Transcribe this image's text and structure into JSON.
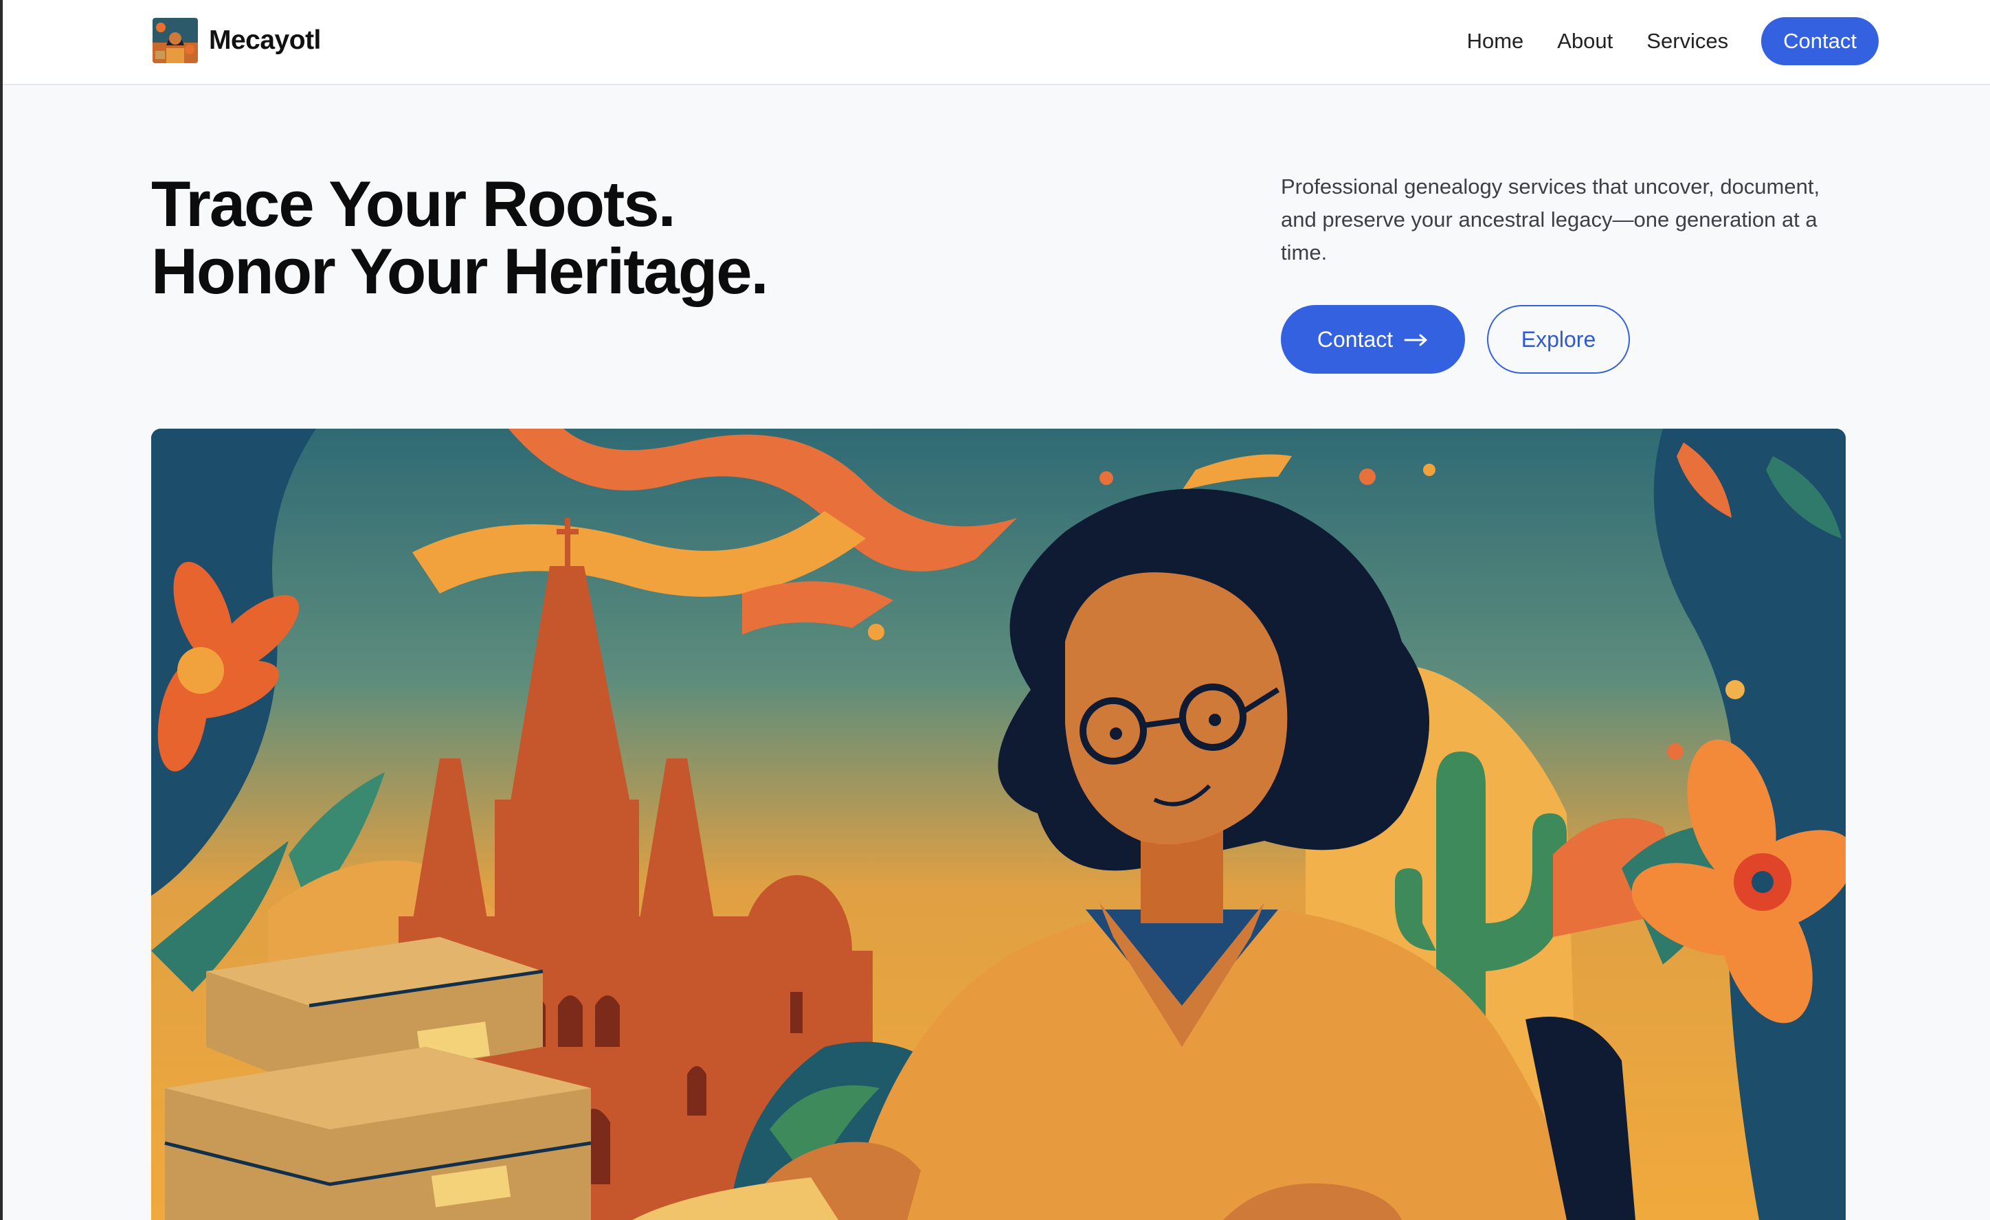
{
  "brand": {
    "name": "Mecayotl",
    "logo_icon": "painting-thumbnail-icon"
  },
  "nav": {
    "items": [
      {
        "label": "Home"
      },
      {
        "label": "About"
      },
      {
        "label": "Services"
      }
    ],
    "cta_label": "Contact"
  },
  "hero": {
    "title_line1": "Trace Your Roots.",
    "title_line2": "Honor Your Heritage.",
    "description": "Professional genealogy services that uncover, document, and preserve your ancestral legacy—one generation at a time.",
    "primary_button": "Contact",
    "primary_button_icon": "arrow-right-icon",
    "secondary_button": "Explore"
  },
  "colors": {
    "accent": "#3461e0",
    "page_background": "#f8f9fb",
    "header_background": "#ffffff",
    "heading_text": "#0c0c0c",
    "body_text": "#3b3f46"
  }
}
